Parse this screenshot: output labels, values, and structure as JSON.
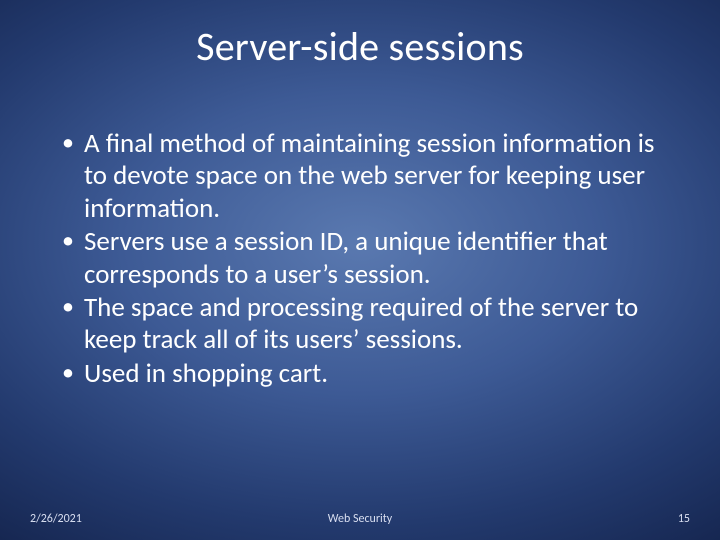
{
  "slide": {
    "title": "Server-side sessions",
    "bullets": [
      "A final method of maintaining session information is to devote space on the web server for keeping user information.",
      "Servers use a session ID, a unique identifier that corresponds to a user’s session.",
      "The space and processing required of the server to keep track all of its users’ sessions.",
      "Used in shopping cart."
    ],
    "footer": {
      "date": "2/26/2021",
      "title": "Web Security",
      "page": "15"
    }
  }
}
